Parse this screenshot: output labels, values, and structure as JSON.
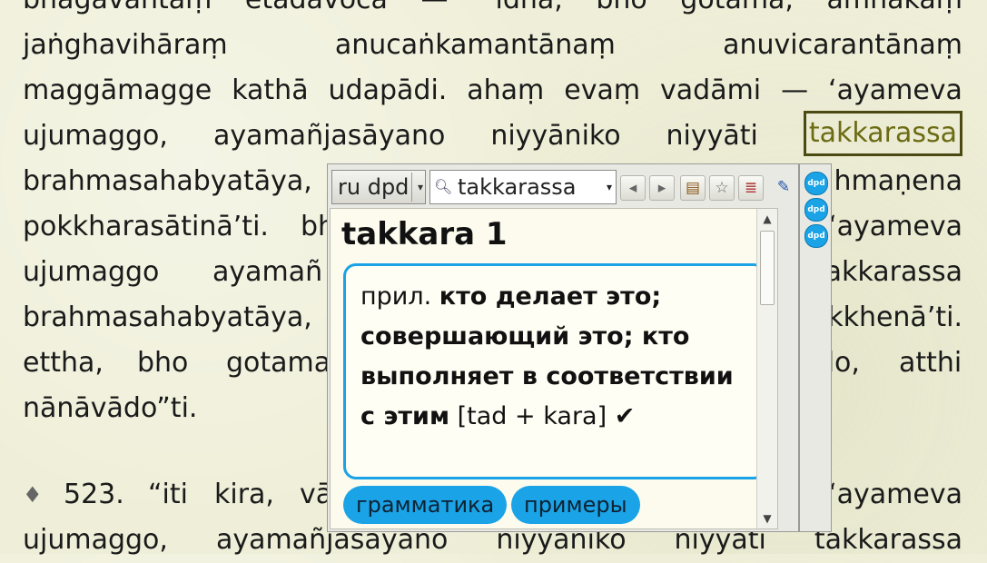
{
  "text": {
    "line0": [
      "bhagavantaṃ",
      "etadavoca",
      "—",
      "“idha,",
      "bho",
      "gotama,",
      "amhākaṃ"
    ],
    "line1": [
      "jaṅghavihāraṃ",
      "anucaṅkamantānaṃ",
      "anuvicarantānaṃ"
    ],
    "line2": [
      "maggāmagge",
      "kathā",
      "udapādi.",
      "ahaṃ",
      "evaṃ",
      "vadāmi",
      "—",
      "‘ayameva"
    ],
    "line3": [
      "ujumaggo,",
      "ayamañjasāyano",
      "niyyāniko",
      "niyyāti",
      "takkarassa"
    ],
    "line4_left": "brahmasahabyatāya,",
    "line4_right": "hmaṇena",
    "line5_left": "pokkharasātinā’ti.",
    "line5_mid": "bh",
    "line5_right": "‘ayameva",
    "line6_left": [
      "ujumaggo",
      "ayamañ"
    ],
    "line6_right": "akkarassa",
    "line7_left": "brahmasahabyatāya,",
    "line7_right": "kkhenā’ti.",
    "line8_left": [
      "ettha,",
      "bho",
      "gotama"
    ],
    "line8_right": [
      "do,",
      "atthi"
    ],
    "line9": "nānāvādo”ti.",
    "line10_left": [
      "♦",
      "523.",
      "“iti",
      "kira,",
      "vā"
    ],
    "line10_right": "‘ayameva",
    "line11": [
      "ujumaggo,",
      "ayamañjasāyano",
      "niyyāniko",
      "niyyāti",
      "takkarassa"
    ]
  },
  "popup": {
    "dict_select": "ru dpd",
    "word_input": "takkarassa",
    "headword": "takkara 1",
    "definition": {
      "pos": "прил.",
      "meaning": "кто делает это; совершающий это; кто выполняет в соответствии с этим",
      "etym": "[tad + kara]",
      "check": "✔"
    },
    "buttons": {
      "grammar": "грамматика",
      "examples": "примеры"
    },
    "side_icons": [
      "dpd",
      "dpd",
      "dpd"
    ]
  },
  "colors": {
    "accent": "#1aa3e6",
    "highlight_border": "#4a4a12",
    "background": "#efefd9"
  }
}
